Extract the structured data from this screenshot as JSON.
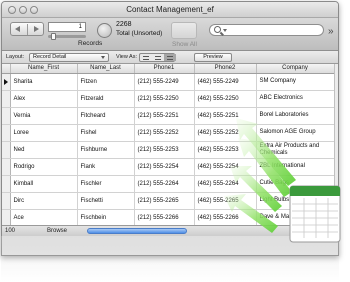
{
  "window": {
    "title": "Contact Management_ef"
  },
  "toolbar": {
    "record_field": "1",
    "records_label": "Records",
    "total_count": "2268",
    "total_label": "Total (Unsorted)",
    "show_all_label": "Show All",
    "search_placeholder": "",
    "overflow": "»"
  },
  "layout_bar": {
    "layout_label": "Layout:",
    "layout_value": "Record Detail",
    "view_as_label": "View As:",
    "preview_label": "Preview"
  },
  "table": {
    "columns": [
      "Name_First",
      "Name_Last",
      "Phone1",
      "Phone2",
      "Company"
    ],
    "rows": [
      [
        "Sharita",
        "Fitzen",
        "(212) 555-2249",
        "(462) 555-2249",
        "SM Company"
      ],
      [
        "Alex",
        "Fitzerald",
        "(212) 555-2250",
        "(462) 555-2250",
        "ABC Electronics"
      ],
      [
        "Vernia",
        "Fitcheard",
        "(212) 555-2251",
        "(462) 555-2251",
        "Borel Laboratories"
      ],
      [
        "Loree",
        "Fishel",
        "(212) 555-2252",
        "(462) 555-2252",
        "Salomon AGE Group"
      ],
      [
        "Ned",
        "Fishburne",
        "(212) 555-2253",
        "(462) 555-2253",
        "Extra Air Products and Chemicals"
      ],
      [
        "Rodrigo",
        "Flank",
        "(212) 555-2254",
        "(462) 555-2254",
        "ZBL International"
      ],
      [
        "Kimball",
        "Fischler",
        "(212) 555-2264",
        "(462) 555-2264",
        "Cutie Bags"
      ],
      [
        "Dirc",
        "Fischetti",
        "(212) 555-2265",
        "(462) 555-2265",
        "Light Bulbs"
      ],
      [
        "Ace",
        "Fischbein",
        "(212) 555-2266",
        "(462) 555-2266",
        "Dave & Mark"
      ]
    ]
  },
  "statusbar": {
    "zoom": "100",
    "mode": "Browse"
  },
  "colors": {
    "arrow_green": "#7ed957",
    "scroll_blue": "#4f8fe6",
    "excel_green": "#3b9a3c"
  },
  "icons": {
    "excel": "spreadsheet-icon",
    "search": "search-icon"
  }
}
